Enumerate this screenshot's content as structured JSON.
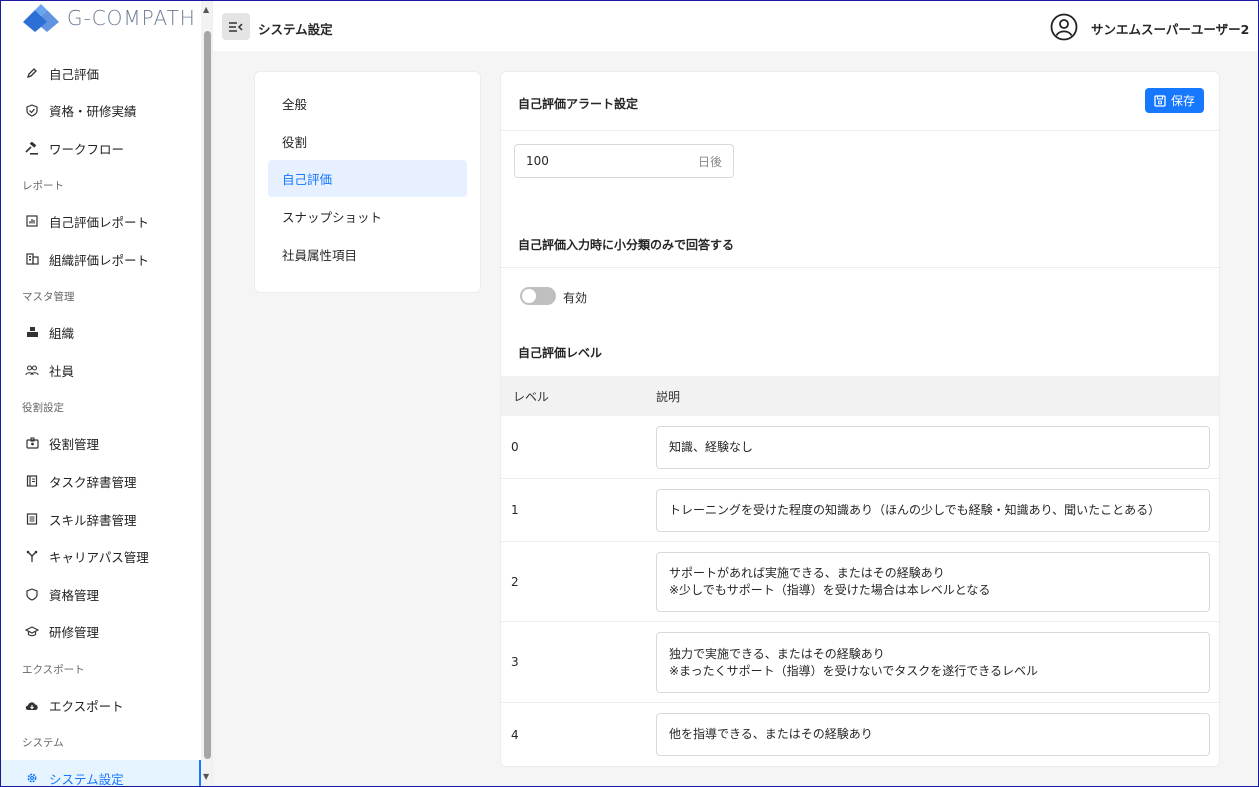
{
  "app": {
    "logo_text": "G-COMPATH",
    "brand_color": "#2c6fd6"
  },
  "sidebar": {
    "items": [
      {
        "label": "自己評価",
        "icon": "pencil-icon"
      },
      {
        "label": "資格・研修実績",
        "icon": "shield-check-icon"
      },
      {
        "label": "ワークフロー",
        "icon": "gavel-icon"
      },
      {
        "label": "自己評価レポート",
        "icon": "bar-chart-icon"
      },
      {
        "label": "組織評価レポート",
        "icon": "building-report-icon"
      },
      {
        "label": "組織",
        "icon": "organization-icon"
      },
      {
        "label": "社員",
        "icon": "people-icon"
      },
      {
        "label": "役割管理",
        "icon": "id-badge-icon"
      },
      {
        "label": "タスク辞書管理",
        "icon": "book-icon"
      },
      {
        "label": "スキル辞書管理",
        "icon": "book-list-icon"
      },
      {
        "label": "キャリアパス管理",
        "icon": "fork-icon"
      },
      {
        "label": "資格管理",
        "icon": "shield-icon"
      },
      {
        "label": "研修管理",
        "icon": "graduation-cap-icon"
      },
      {
        "label": "エクスポート",
        "icon": "cloud-download-icon"
      },
      {
        "label": "システム設定",
        "icon": "gear-icon"
      }
    ],
    "groups": [
      "レポート",
      "マスタ管理",
      "役割設定",
      "エクスポート",
      "システム"
    ]
  },
  "header": {
    "title": "システム設定",
    "user_name": "サンエムスーパーユーザー2"
  },
  "settings_nav": {
    "items": [
      "全般",
      "役割",
      "自己評価",
      "スナップショット",
      "社員属性項目"
    ],
    "active": "自己評価"
  },
  "panel": {
    "alert_title": "自己評価アラート設定",
    "save_label": "保存",
    "days_value": "100",
    "days_suffix": "日後",
    "subcategory_title": "自己評価入力時に小分類のみで回答する",
    "toggle_label": "有効",
    "toggle_on": false,
    "level_title": "自己評価レベル",
    "table_headers": {
      "level": "レベル",
      "description": "説明"
    },
    "levels": [
      {
        "level": "0",
        "line1": "知識、経験なし",
        "line2": ""
      },
      {
        "level": "1",
        "line1": "トレーニングを受けた程度の知識あり（ほんの少しでも経験・知識あり、聞いたことある）",
        "line2": ""
      },
      {
        "level": "2",
        "line1": "サポートがあれば実施できる、またはその経験あり",
        "line2": "※少しでもサポート（指導）を受けた場合は本レベルとなる"
      },
      {
        "level": "3",
        "line1": "独力で実施できる、またはその経験あり",
        "line2": "※まったくサポート（指導）を受けないでタスクを遂行できるレベル"
      },
      {
        "level": "4",
        "line1": "他を指導できる、またはその経験あり",
        "line2": ""
      }
    ]
  }
}
